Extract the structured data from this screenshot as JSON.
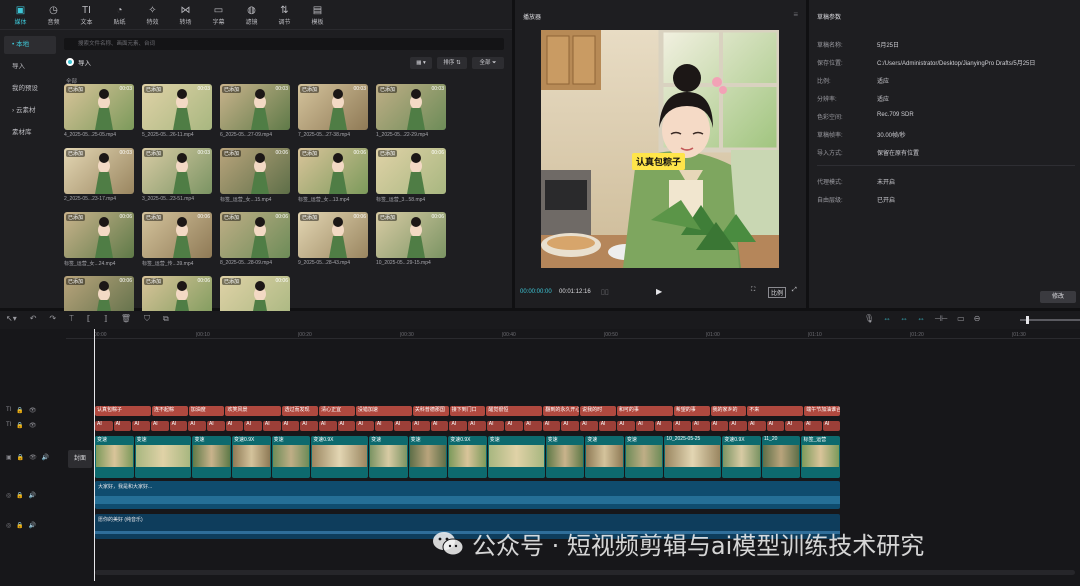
{
  "toolbar": {
    "items": [
      {
        "label": "媒体",
        "icon": "media-icon",
        "active": true
      },
      {
        "label": "音频",
        "icon": "audio-icon"
      },
      {
        "label": "文本",
        "icon": "text-icon"
      },
      {
        "label": "贴纸",
        "icon": "sticker-icon"
      },
      {
        "label": "特效",
        "icon": "effects-icon"
      },
      {
        "label": "转场",
        "icon": "transition-icon"
      },
      {
        "label": "字幕",
        "icon": "captions-icon"
      },
      {
        "label": "滤镜",
        "icon": "filter-icon"
      },
      {
        "label": "调节",
        "icon": "adjust-icon"
      },
      {
        "label": "模板",
        "icon": "template-icon"
      }
    ]
  },
  "sidebar": {
    "items": [
      {
        "label": "• 本地",
        "active": true
      },
      {
        "label": "导入"
      },
      {
        "label": "我的预设"
      },
      {
        "label": "› 云素材"
      },
      {
        "label": "素材库"
      }
    ]
  },
  "media": {
    "search_placeholder": "搜索文件名称、画面元素、台词",
    "import_label": "导入",
    "sort_label": "排序",
    "all_label": "全部",
    "grid_label": "全部",
    "clips": [
      {
        "badge": "已添加",
        "duration": "00:03",
        "name": "4_2025-05...25-05.mp4"
      },
      {
        "badge": "已添加",
        "duration": "00:03",
        "name": "5_2025-05...26-11.mp4"
      },
      {
        "badge": "已添加",
        "duration": "00:03",
        "name": "6_2025-05...27-09.mp4"
      },
      {
        "badge": "已添加",
        "duration": "00:03",
        "name": "7_2025-05...27-38.mp4"
      },
      {
        "badge": "已添加",
        "duration": "00:03",
        "name": "1_2025-05...22-29.mp4"
      },
      {
        "badge": "已添加",
        "duration": "00:03",
        "name": "2_2025-05...23-17.mp4"
      },
      {
        "badge": "已添加",
        "duration": "00:03",
        "name": "3_2025-05...23-51.mp4"
      },
      {
        "badge": "已添加",
        "duration": "00:06",
        "name": "标签_运营_女...15.mp4"
      },
      {
        "badge": "已添加",
        "duration": "00:06",
        "name": "标签_运营_女...13.mp4"
      },
      {
        "badge": "已添加",
        "duration": "00:06",
        "name": "标签_运营_3...58.mp4"
      },
      {
        "badge": "已添加",
        "duration": "00:06",
        "name": "标签_运营_女...24.mp4"
      },
      {
        "badge": "已添加",
        "duration": "00:06",
        "name": "标签_运营_传...39.mp4"
      },
      {
        "badge": "已添加",
        "duration": "00:06",
        "name": "8_2025-05...28-09.mp4"
      },
      {
        "badge": "已添加",
        "duration": "00:06",
        "name": "9_2025-05...28-43.mp4"
      },
      {
        "badge": "已添加",
        "duration": "00:06",
        "name": "10_2025-05...29-15.mp4"
      },
      {
        "badge": "已添加",
        "duration": "00:06",
        "name": ""
      },
      {
        "badge": "已添加",
        "duration": "00:06",
        "name": ""
      },
      {
        "badge": "已添加",
        "duration": "00:06",
        "name": ""
      }
    ]
  },
  "player": {
    "title": "播放器",
    "caption": "认真包粽子",
    "timecode": "00:00:00:00",
    "duration": "00:01:12:16",
    "ratio_label": "比例"
  },
  "params": {
    "title": "草稿参数",
    "rows": [
      {
        "k": "草稿名称:",
        "v": "5月25日"
      },
      {
        "k": "保存位置:",
        "v": "C:/Users/Administrator/Desktop/JianyingPro Drafts/5月25日"
      },
      {
        "k": "比例:",
        "v": "适应"
      },
      {
        "k": "分辨率:",
        "v": "适应"
      },
      {
        "k": "色彩空间:",
        "v": "Rec.709 SDR"
      },
      {
        "k": "草稿帧率:",
        "v": "30.00帧/秒"
      },
      {
        "k": "导入方式:",
        "v": "保留在原有位置"
      },
      {
        "k": "代理模式:",
        "v": "未开启"
      },
      {
        "k": "自由层级:",
        "v": "已开启"
      }
    ],
    "modify_label": "修改"
  },
  "timeline": {
    "ruler": [
      "00:00",
      "|00:10",
      "|00:20",
      "|00:30",
      "|00:40",
      "|00:50",
      "|01:00",
      "|01:10",
      "|01:20",
      "|01:30"
    ],
    "cover_label": "封面",
    "text_track1": [
      "认真包粽子",
      "连不起粽",
      "加油度",
      "欢笑风景",
      "透过而发现",
      "清心正宜",
      "没错加速",
      "关科普德那国",
      "接下到门口",
      "醒觉很恒",
      "翻到的永久开心了",
      "说我的时",
      "和可的事",
      "希望的事",
      "我的家乡的",
      "不来",
      "端午节加油谁合一"
    ],
    "text_track2_label": "AI",
    "video_labels": [
      "变速",
      "变速",
      "变速",
      "变速0.9X",
      "变速",
      "变速0.9X",
      "变速",
      "变速",
      "变速0.9X",
      "变速",
      "变速",
      "变速",
      "变速",
      "10_2025-05-25",
      "变速0.9X",
      "11_20",
      "标签_运营"
    ],
    "audio1_name": "大家好，我是和大家好...",
    "audio2_name": "愿你的美好 (纯音乐)"
  },
  "watermark": "公众号 · 短视频剪辑与ai模型训练技术研究"
}
